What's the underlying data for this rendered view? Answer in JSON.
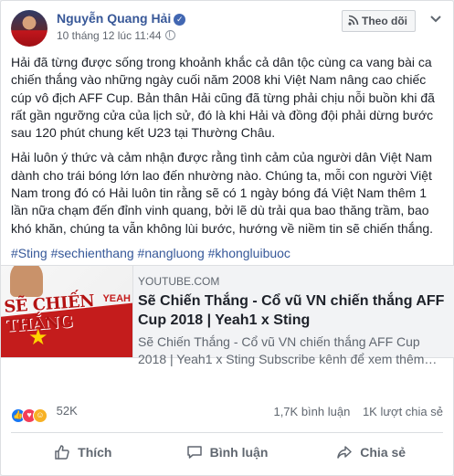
{
  "post": {
    "author": "Nguyễn Quang Hải",
    "timestamp": "10 tháng 12 lúc 11:44",
    "follow_label": "Theo dõi",
    "paragraphs": [
      "Hải đã từng được sống trong khoảnh khắc cả dân tộc cùng ca vang bài ca chiến thắng vào những ngày cuối năm 2008 khi Việt Nam nâng cao chiếc cúp vô địch AFF Cup. Bản thân Hải cũng đã từng phải chịu nỗi buồn khi đã rất gần ngưỡng cửa của lịch sử, đó là khi Hải và đồng đội phải dừng bước sau 120 phút chung kết U23 tại Thường Châu.",
      "Hải luôn ý thức và cảm nhận được rằng tình cảm của người dân Việt Nam dành cho trái bóng lớn lao đến nhường nào. Chúng ta, mỗi con người Việt Nam trong đó có Hải luôn tin rằng sẽ có 1 ngày bóng đá Việt Nam thêm 1 lần nữa chạm đến đỉnh vinh quang, bởi lẽ dù trải qua bao thăng trầm, bao khó khăn, chúng ta vẫn không lùi bước, hướng về niềm tin sẽ chiến thắng."
    ],
    "hashtags": "#Sting #sechienthang #nangluong #khongluibuoc"
  },
  "link": {
    "domain": "YOUTUBE.COM",
    "title": "Sẽ Chiến Thắng - Cổ vũ VN chiến thắng AFF Cup 2018 | Yeah1 x Sting",
    "description": "Sẽ Chiến Thắng - Cổ vũ VN chiến thắng AFF Cup 2018 | Yeah1 x Sting Subscribe kênh để xem thêm…",
    "thumb_title": "SẼ CHIẾN THẮNG",
    "thumb_brand": "YEAH"
  },
  "stats": {
    "reactions": "52K",
    "comments": "1,7K bình luận",
    "shares": "1K lượt chia sẻ"
  },
  "actions": {
    "like": "Thích",
    "comment": "Bình luận",
    "share": "Chia sẻ"
  },
  "colors": {
    "link_blue": "#385898",
    "like": "#1877f2",
    "love": "#f33e58",
    "haha": "#f7b125"
  }
}
